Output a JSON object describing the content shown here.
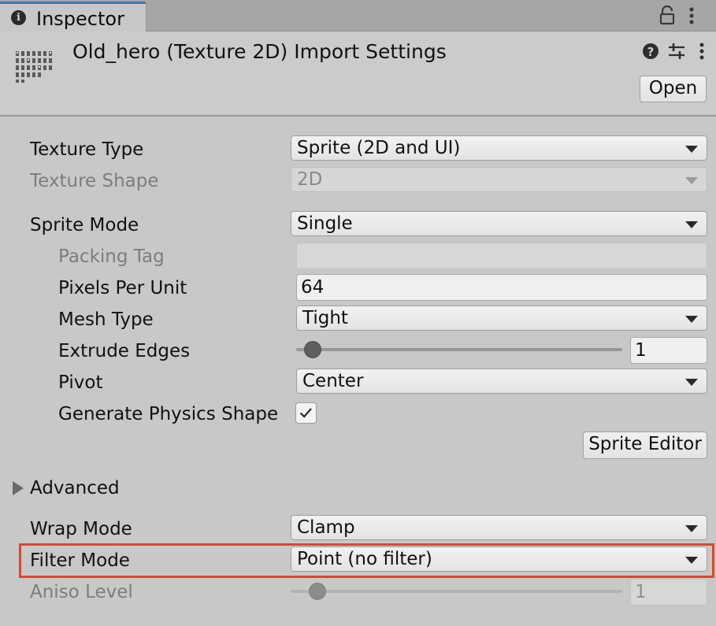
{
  "tab": {
    "title": "Inspector",
    "icons": [
      "info-icon",
      "lock-icon",
      "kebab-menu-icon"
    ]
  },
  "header": {
    "title": "Old_hero (Texture 2D) Import Settings",
    "open_label": "Open",
    "icons": [
      "help-icon",
      "preset-sliders-icon",
      "kebab-menu-icon"
    ]
  },
  "fields": {
    "texture_type": {
      "label": "Texture Type",
      "value": "Sprite (2D and UI)"
    },
    "texture_shape": {
      "label": "Texture Shape",
      "value": "2D"
    },
    "sprite_mode": {
      "label": "Sprite Mode",
      "value": "Single"
    },
    "packing_tag": {
      "label": "Packing Tag",
      "value": ""
    },
    "pixels_per_unit": {
      "label": "Pixels Per Unit",
      "value": "64"
    },
    "mesh_type": {
      "label": "Mesh Type",
      "value": "Tight"
    },
    "extrude_edges": {
      "label": "Extrude Edges",
      "value": "1",
      "fraction": 0.05
    },
    "pivot": {
      "label": "Pivot",
      "value": "Center"
    },
    "generate_physics_shape": {
      "label": "Generate Physics Shape",
      "checked": true
    },
    "sprite_editor_label": "Sprite Editor",
    "advanced_label": "Advanced",
    "wrap_mode": {
      "label": "Wrap Mode",
      "value": "Clamp"
    },
    "filter_mode": {
      "label": "Filter Mode",
      "value": "Point (no filter)"
    },
    "aniso_level": {
      "label": "Aniso Level",
      "value": "1",
      "fraction": 0.08
    }
  },
  "colors": {
    "highlight": "#e2452a",
    "tab_accent": "#3a79bb",
    "panel_bg": "#c8c8c8"
  }
}
